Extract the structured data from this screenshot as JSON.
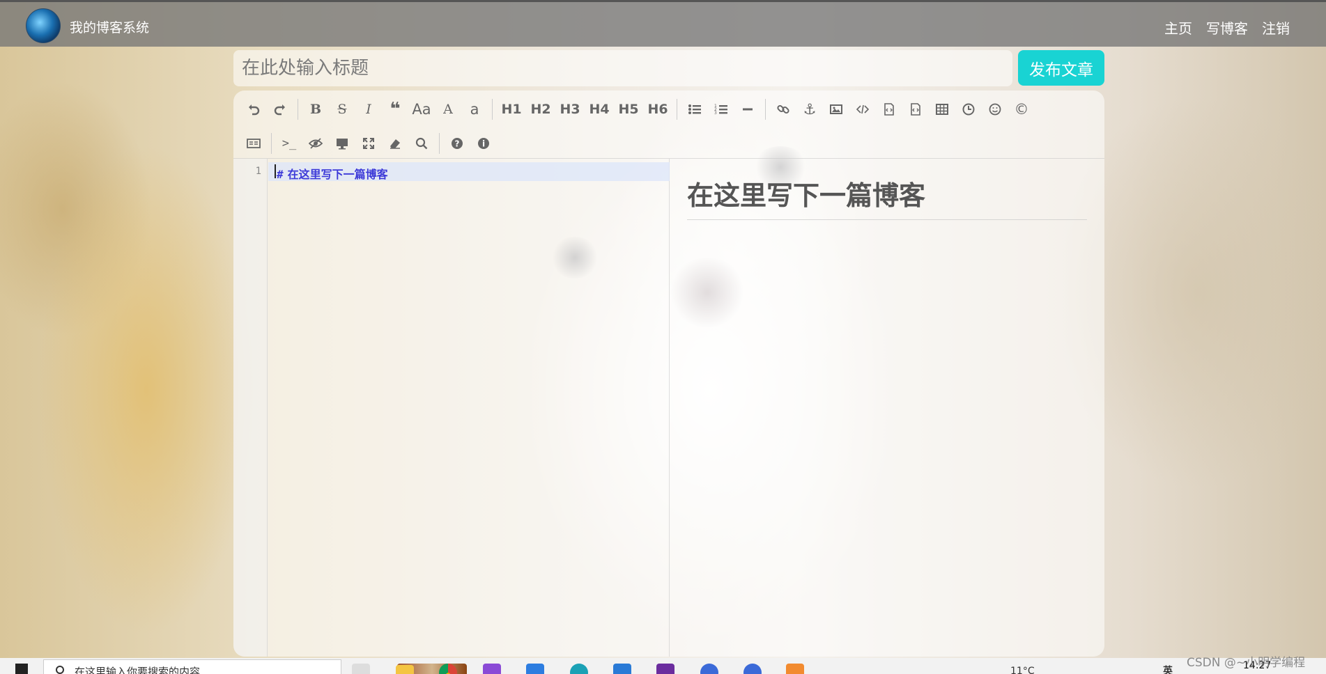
{
  "navbar": {
    "brand": "我的博客系统",
    "links": [
      "主页",
      "写博客",
      "注销"
    ]
  },
  "editor_header": {
    "title_placeholder": "在此处输入标题",
    "publish_label": "发布文章"
  },
  "toolbar": {
    "headings": [
      "H1",
      "H2",
      "H3",
      "H4",
      "H5",
      "H6"
    ],
    "text_buttons": [
      "B",
      "S",
      "I",
      "Aa",
      "A",
      "a"
    ]
  },
  "editor": {
    "line_number": "1",
    "code_hash": "#",
    "code_text": "在这里写下一篇博客",
    "preview_heading": "在这里写下一篇博客"
  },
  "taskbar": {
    "search_placeholder": "在这里输入你要搜索的内容",
    "weather": "11°C",
    "ime": "英",
    "time": "14:27"
  },
  "watermark": "CSDN @~小明学编程",
  "colors": {
    "publish_button": "#19d3d3",
    "navbar": "#767676",
    "code_text": "#3d3ad8"
  }
}
